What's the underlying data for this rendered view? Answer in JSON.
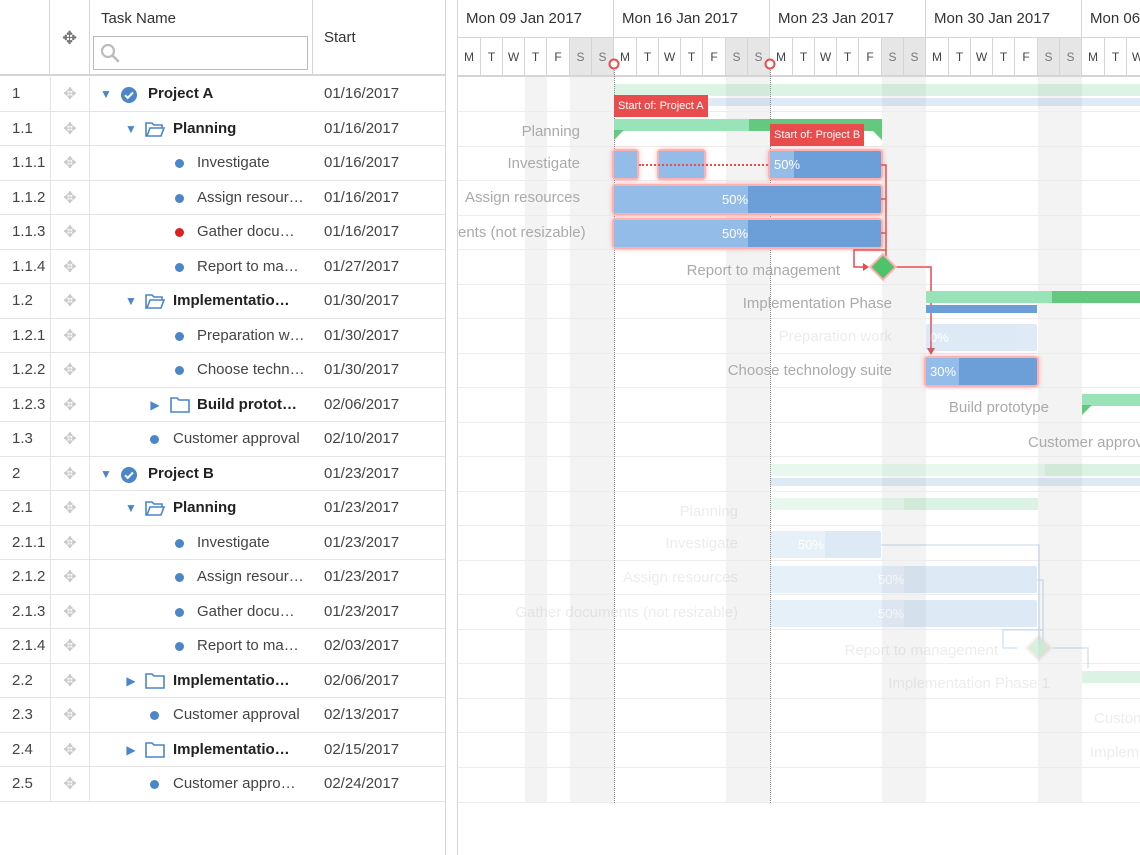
{
  "grid": {
    "header": {
      "task_name": "Task Name",
      "start": "Start",
      "search_placeholder": ""
    },
    "rows": [
      {
        "num": "1",
        "name": "Project A",
        "start": "01/16/2017"
      },
      {
        "num": "1.1",
        "name": "Planning",
        "start": "01/16/2017"
      },
      {
        "num": "1.1.1",
        "name": "Investigate",
        "start": "01/16/2017"
      },
      {
        "num": "1.1.2",
        "name": "Assign resour…",
        "start": "01/16/2017"
      },
      {
        "num": "1.1.3",
        "name": "Gather docum…",
        "start": "01/16/2017"
      },
      {
        "num": "1.1.4",
        "name": "Report to man…",
        "start": "01/27/2017"
      },
      {
        "num": "1.2",
        "name": "Implementatio…",
        "start": "01/30/2017"
      },
      {
        "num": "1.2.1",
        "name": "Preparation w…",
        "start": "01/30/2017"
      },
      {
        "num": "1.2.2",
        "name": "Choose techn…",
        "start": "01/30/2017"
      },
      {
        "num": "1.2.3",
        "name": "Build protot…",
        "start": "02/06/2017"
      },
      {
        "num": "1.3",
        "name": "Customer approval",
        "start": "02/10/2017"
      },
      {
        "num": "2",
        "name": "Project B",
        "start": "01/23/2017"
      },
      {
        "num": "2.1",
        "name": "Planning",
        "start": "01/23/2017"
      },
      {
        "num": "2.1.1",
        "name": "Investigate",
        "start": "01/23/2017"
      },
      {
        "num": "2.1.2",
        "name": "Assign resour…",
        "start": "01/23/2017"
      },
      {
        "num": "2.1.3",
        "name": "Gather docum…",
        "start": "01/23/2017"
      },
      {
        "num": "2.1.4",
        "name": "Report to man…",
        "start": "02/03/2017"
      },
      {
        "num": "2.2",
        "name": "Implementatio…",
        "start": "02/06/2017"
      },
      {
        "num": "2.3",
        "name": "Customer approval",
        "start": "02/13/2017"
      },
      {
        "num": "2.4",
        "name": "Implementatio…",
        "start": "02/15/2017"
      },
      {
        "num": "2.5",
        "name": "Customer approv…",
        "start": "02/24/2017"
      }
    ]
  },
  "timeline": {
    "weeks": [
      "Mon 09 Jan 2017",
      "Mon 16 Jan 2017",
      "Mon 23 Jan 2017",
      "Mon 30 Jan 2017",
      "Mon 06"
    ],
    "days": [
      "M",
      "T",
      "W",
      "T",
      "F",
      "S",
      "S"
    ],
    "markers": {
      "project_a": "Start of: Project A",
      "project_b": "Start of: Project B"
    },
    "labels": {
      "planning": "Planning",
      "investigate": "Investigate",
      "assign": "Assign resources",
      "gather": "ents (not resizable)",
      "report": "Report to management",
      "impl": "Implementation Phase",
      "prep": "Preparation work",
      "choose": "Choose technology suite",
      "build": "Build prototype",
      "cust": "Customer approv",
      "b_planning": "Planning",
      "b_investigate": "Investigate",
      "b_assign": "Assign resources",
      "b_gather": "Gather documents (not resizable)",
      "b_report": "Report to management",
      "b_impl": "Implementation Phase 1",
      "b_cust": "Custon",
      "b_impl2": "Implem"
    },
    "pct": {
      "investigate": "50%",
      "assign": "50%",
      "gather": "50%",
      "prep": "0%",
      "choose": "30%",
      "b_investigate": "50%",
      "b_assign": "50%",
      "b_gather": "50%"
    }
  },
  "colors": {
    "task": "#6c9fd8",
    "task_done": "#93bce8",
    "summary": "#64c97e",
    "marker": "#e84c4c",
    "accent": "#4a86c8"
  }
}
